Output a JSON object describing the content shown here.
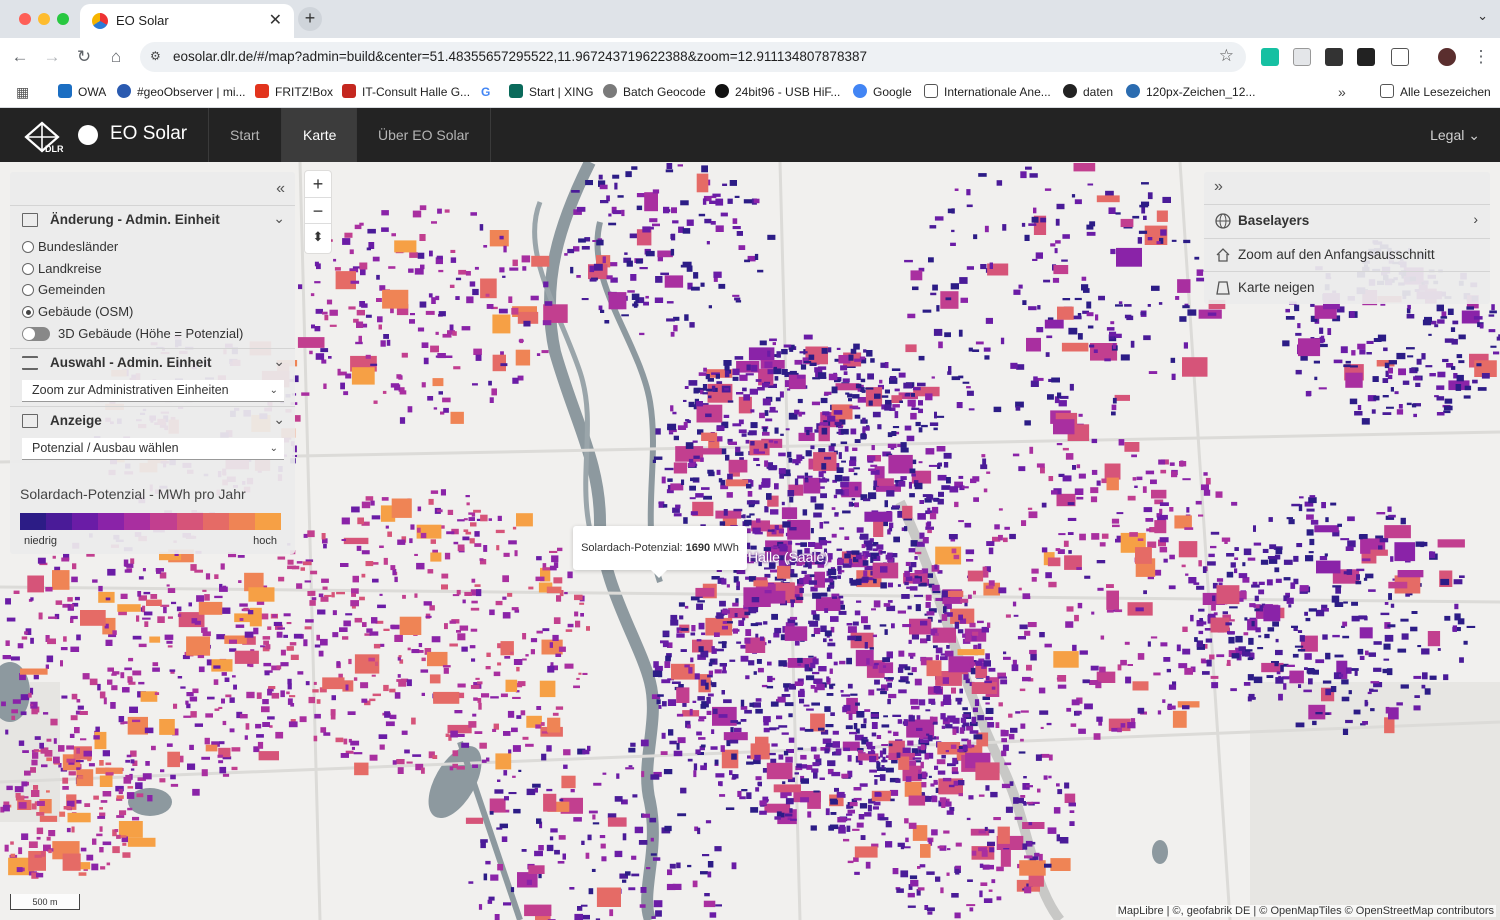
{
  "browser": {
    "tab_title": "EO Solar",
    "url": "eosolar.dlr.de/#/map?admin=build&center=51.48355657295522,11.967243719622388&zoom=12.911134807878387",
    "bookmarks": [
      {
        "label": "OWA",
        "color": "#1b6ec2"
      },
      {
        "label": "#geoObserver | mi...",
        "color": "#2a5ab0"
      },
      {
        "label": "FRITZ!Box",
        "color": "#e2341d"
      },
      {
        "label": "IT-Consult Halle G...",
        "color": "#c4271f"
      },
      {
        "label": "",
        "color": "#4285f4"
      },
      {
        "label": "Start | XING",
        "color": "#0a6a5b"
      },
      {
        "label": "Batch Geocode",
        "color": "#7a7a7a"
      },
      {
        "label": "24bit96 - USB HiF...",
        "color": "#111111"
      },
      {
        "label": "Google",
        "color": "#4285f4"
      },
      {
        "label": "Internationale Ane...",
        "color": "#555555"
      },
      {
        "label": "daten",
        "color": "#222222"
      },
      {
        "label": "120px-Zeichen_12...",
        "color": "#2b6cb0"
      }
    ],
    "all_bookmarks": "Alle Lesezeichen"
  },
  "app": {
    "brand_org": "DLR",
    "brand": "EO Solar",
    "nav": [
      "Start",
      "Karte",
      "Über EO Solar"
    ],
    "active_nav": "Karte",
    "legal": "Legal"
  },
  "left_panel": {
    "section_admin": "Änderung - Admin. Einheit",
    "radios": [
      {
        "label": "Bundesländer",
        "checked": false
      },
      {
        "label": "Landkreise",
        "checked": false
      },
      {
        "label": "Gemeinden",
        "checked": false
      },
      {
        "label": "Gebäude (OSM)",
        "checked": true
      }
    ],
    "toggle_3d": "3D Gebäude (Höhe = Potenzial)",
    "section_select": "Auswahl - Admin. Einheit",
    "select_zoom": "Zoom zur Administrativen Einheiten",
    "section_display": "Anzeige",
    "select_display": "Potenzial / Ausbau wählen",
    "legend_title": "Solardach-Potenzial - MWh pro Jahr",
    "legend_low": "niedrig",
    "legend_high": "hoch",
    "legend_colors": [
      "#2c1c86",
      "#4a1b98",
      "#6a1ca6",
      "#8a23a8",
      "#a92fa0",
      "#c23f8f",
      "#d65479",
      "#e56b66",
      "#ef8455",
      "#f6a045"
    ]
  },
  "right_panel": {
    "baselayers": "Baselayers",
    "zoom_home": "Zoom auf den Anfangsausschnitt",
    "tilt": "Karte neigen"
  },
  "map": {
    "tooltip_label": "Solardach-Potenzial:",
    "tooltip_value": "1690",
    "tooltip_unit": "MWh",
    "city_label": "Halle (Saale)",
    "scale": "500 m",
    "attribution": "MapLibre | ©, geofabrik DE | © OpenMapTiles © OpenStreetMap contributors"
  }
}
